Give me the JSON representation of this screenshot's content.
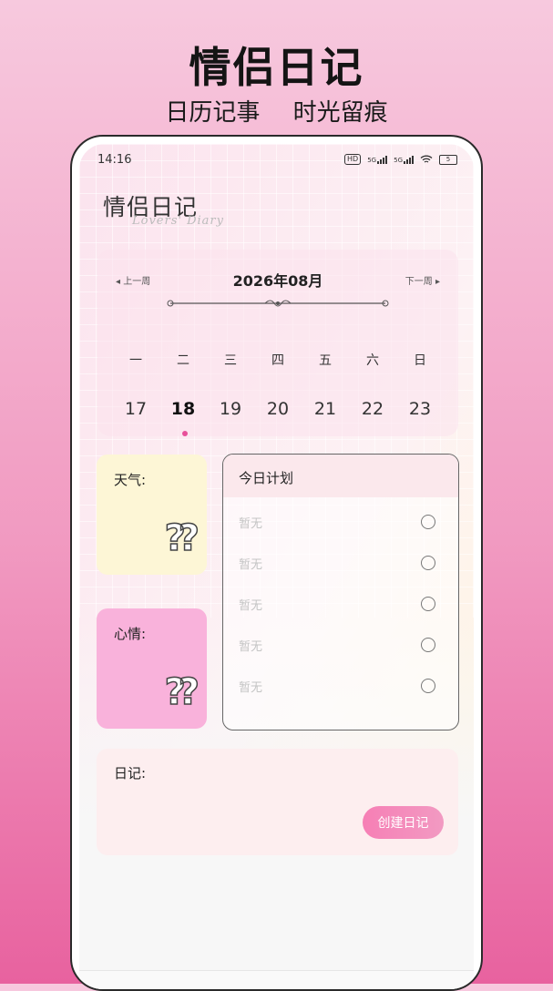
{
  "promo": {
    "title": "情侣日记",
    "subtitle": "日历记事 时光留痕"
  },
  "status_bar": {
    "time": "14:16",
    "hd": "HD",
    "net1": "5G",
    "net2": "5G",
    "battery": "5"
  },
  "app": {
    "title": "情侣日记",
    "subtitle": "Lovers' Diary"
  },
  "calendar": {
    "prev_week": "◂ 上一周",
    "next_week": "下一周 ▸",
    "month": "2026年08月",
    "weekdays": [
      "一",
      "二",
      "三",
      "四",
      "五",
      "六",
      "日"
    ],
    "dates": [
      "17",
      "18",
      "19",
      "20",
      "21",
      "22",
      "23"
    ],
    "selected_date": "18"
  },
  "weather": {
    "label": "天气:",
    "icon": "question-mark-icon",
    "value": "??"
  },
  "mood": {
    "label": "心情:",
    "icon": "question-mark-icon",
    "value": "??"
  },
  "plan": {
    "title": "今日计划",
    "items": [
      {
        "text": "暂无"
      },
      {
        "text": "暂无"
      },
      {
        "text": "暂无"
      },
      {
        "text": "暂无"
      },
      {
        "text": "暂无"
      }
    ]
  },
  "diary": {
    "label": "日记:",
    "create_label": "创建日记"
  },
  "colors": {
    "accent": "#f67fb5",
    "selected_dot": "#e8509a",
    "weather_bg": "#fdf6d6",
    "mood_bg": "#f9b2db"
  }
}
